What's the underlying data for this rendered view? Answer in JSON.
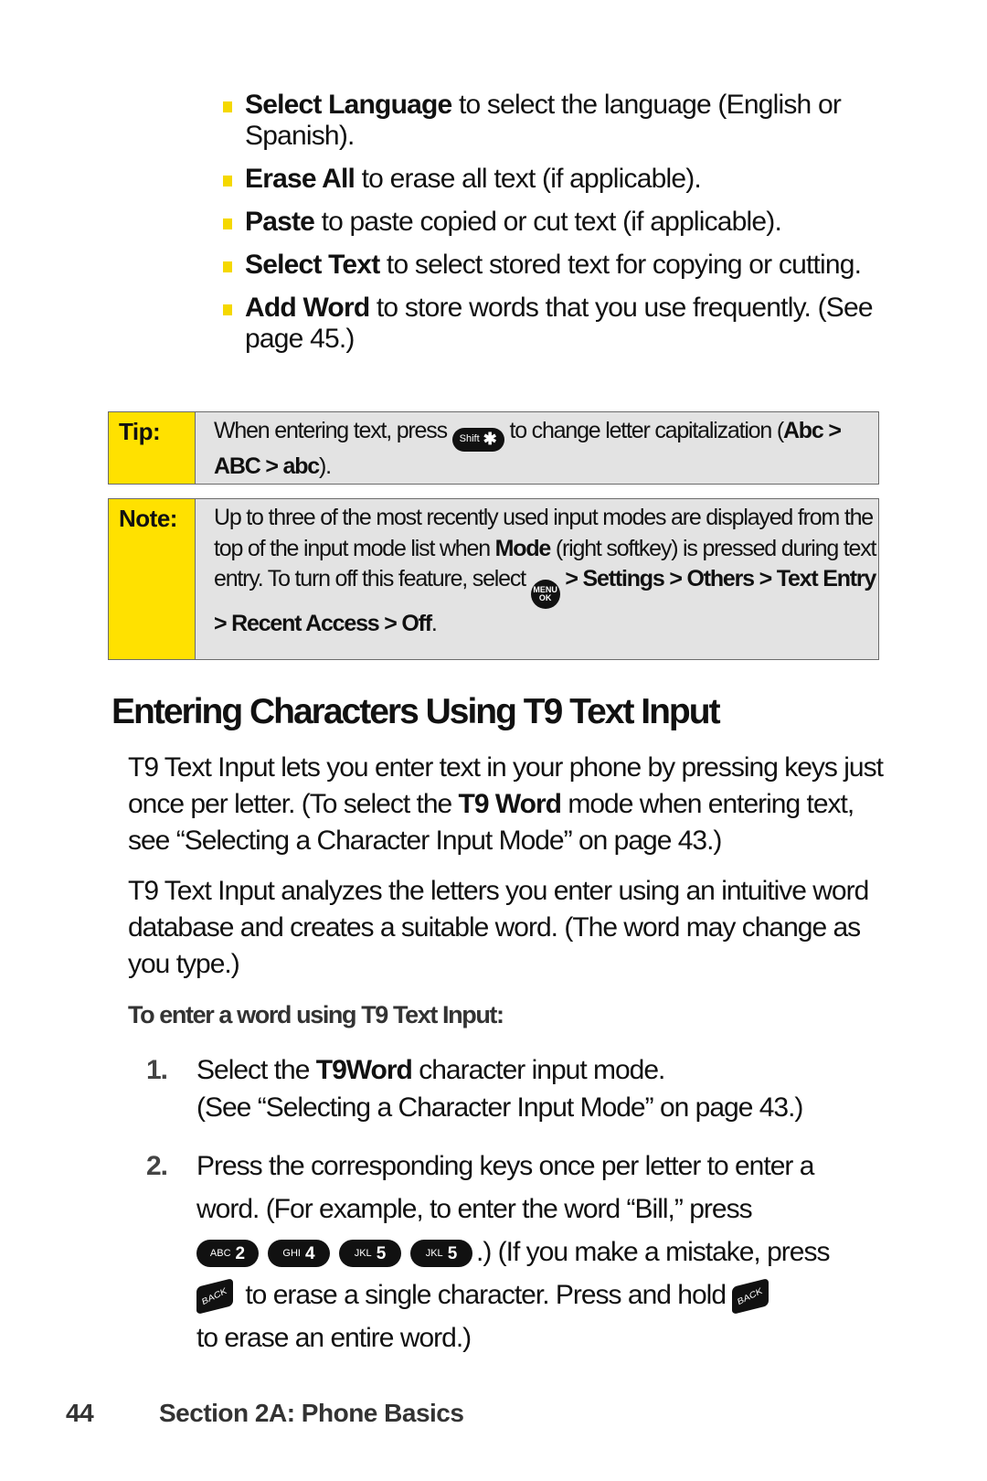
{
  "options_list": [
    {
      "term": "Select Language",
      "desc": " to select the language (English or Spanish)."
    },
    {
      "term": "Erase All",
      "desc": " to erase all text (if applicable)."
    },
    {
      "term": "Paste",
      "desc": " to paste copied or cut text (if applicable)."
    },
    {
      "term": "Select Text",
      "desc": " to select stored text for copying or cutting."
    },
    {
      "term": "Add Word",
      "desc": " to store words that you use frequently. (See page 45.)"
    }
  ],
  "tip": {
    "label": "Tip:",
    "text_before": "When entering text, press ",
    "key_label": "Shift",
    "key_symbol": "✱",
    "text_after": " to change letter capitalization (",
    "mode1": "Abc",
    "sep1": " > ",
    "mode2": "ABC",
    "sep2": " > ",
    "mode3": "abc",
    "text_end": ")."
  },
  "note": {
    "label": "Note:",
    "text1": "Up to three of the most recently used input modes are displayed from the top of the input mode list when ",
    "mode_word": "Mode",
    "text2": " (right softkey) is pressed during text entry. To turn off this feature, select ",
    "menu_key_top": "MENU",
    "menu_key_bottom": "OK",
    "path": " > Settings > Others > Text Entry > Recent Access > Off",
    "text_end": "."
  },
  "section": {
    "heading": "Entering Characters Using T9 Text Input",
    "para1_a": "T9 Text Input lets you enter text in your phone by pressing keys just once per letter. (To select the ",
    "para1_bold": "T9 Word",
    "para1_b": " mode when entering text, see “Selecting a Character Input Mode” on page 43.)",
    "para2": "T9 Text Input analyzes the letters you enter using an intuitive word database and creates a suitable word. (The word may change as you type.)",
    "subheading": "To enter a word using T9 Text Input:"
  },
  "steps": [
    {
      "num": "1.",
      "text_a": "Select the ",
      "bold": "T9Word",
      "text_b": " character input mode.",
      "sub": "(See “Selecting a Character Input Mode” on page 43.)"
    },
    {
      "num": "2.",
      "text_a": "Press the corresponding keys once per letter to enter a word. (For example, to enter the word “Bill,” press",
      "keys": [
        {
          "letters": "ABC",
          "digit": "2"
        },
        {
          "letters": "GHI",
          "digit": "4"
        },
        {
          "letters": "JKL",
          "digit": "5"
        },
        {
          "letters": "JKL",
          "digit": "5"
        }
      ],
      "text_b": ".) (If you make a mistake, press",
      "back_label": "BACK",
      "text_c": " to erase a single character. Press and hold ",
      "text_d": " to erase an entire word.)"
    }
  ],
  "footer": {
    "page_number": "44",
    "section_title": "Section 2A: Phone Basics"
  },
  "colors": {
    "callout_label_bg": "#ffe100",
    "callout_body_bg": "#e3e3e3",
    "bullet": "#f5d800"
  }
}
